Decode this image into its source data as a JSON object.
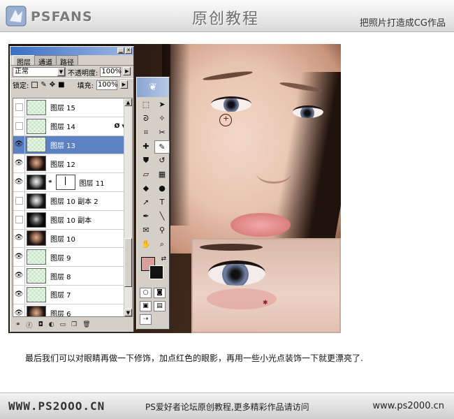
{
  "header": {
    "logo_text": "PSFANS",
    "title": "原创教程",
    "subtitle": "把照片打造成CG作品"
  },
  "layers_panel": {
    "tabs": [
      {
        "label": "图层",
        "active": true
      },
      {
        "label": "通道",
        "active": false
      },
      {
        "label": "路径",
        "active": false
      }
    ],
    "blend_mode": "正常",
    "opacity_label": "不透明度:",
    "opacity_value": "100%",
    "lock_label": "锁定:",
    "fill_label": "填充:",
    "fill_value": "100%",
    "layers": [
      {
        "name": "图层 15",
        "visible": false,
        "thumb": "checker",
        "selected": false
      },
      {
        "name": "图层 14",
        "visible": false,
        "thumb": "checker",
        "selected": false,
        "fx": true
      },
      {
        "name": "图层 13",
        "visible": true,
        "thumb": "checker",
        "selected": true
      },
      {
        "name": "图层 12",
        "visible": true,
        "thumb": "photo",
        "selected": false
      },
      {
        "name": "图层 11",
        "visible": true,
        "thumb": "photo-bw",
        "selected": false,
        "mask": true
      },
      {
        "name": "图层 10 副本 2",
        "visible": false,
        "thumb": "photo-bw",
        "selected": false
      },
      {
        "name": "图层 10 副本",
        "visible": false,
        "thumb": "photo-dk",
        "selected": false
      },
      {
        "name": "图层 10",
        "visible": true,
        "thumb": "photo",
        "selected": false
      },
      {
        "name": "图层 9",
        "visible": true,
        "thumb": "checker",
        "selected": false
      },
      {
        "name": "图层 8",
        "visible": true,
        "thumb": "checker",
        "selected": false
      },
      {
        "name": "图层 7",
        "visible": true,
        "thumb": "checker",
        "selected": false
      },
      {
        "name": "图层 6",
        "visible": true,
        "thumb": "photo",
        "selected": false
      }
    ]
  },
  "toolbox": {
    "foreground_color": "#d9a09a",
    "background_color": "#111111",
    "tools": [
      "marquee-icon",
      "move-icon",
      "lasso-icon",
      "magic-wand-icon",
      "crop-icon",
      "slice-icon",
      "healing-icon",
      "brush-icon",
      "stamp-icon",
      "history-brush-icon",
      "eraser-icon",
      "gradient-icon",
      "blur-icon",
      "dodge-icon",
      "path-select-icon",
      "type-icon",
      "pen-icon",
      "shape-icon",
      "notes-icon",
      "eyedropper-icon",
      "hand-icon",
      "zoom-icon"
    ],
    "active_tool": "brush-icon"
  },
  "caption": "最后我们可以对眼睛再做一下修饰，加点红色的眼影，再用一些小光点装饰一下就更漂亮了.",
  "footer": {
    "left": "WWW.PS2OOO.CN",
    "middle": "PS爱好者论坛原创教程,更多精彩作品请访问",
    "right": "www.ps2000.cn"
  }
}
